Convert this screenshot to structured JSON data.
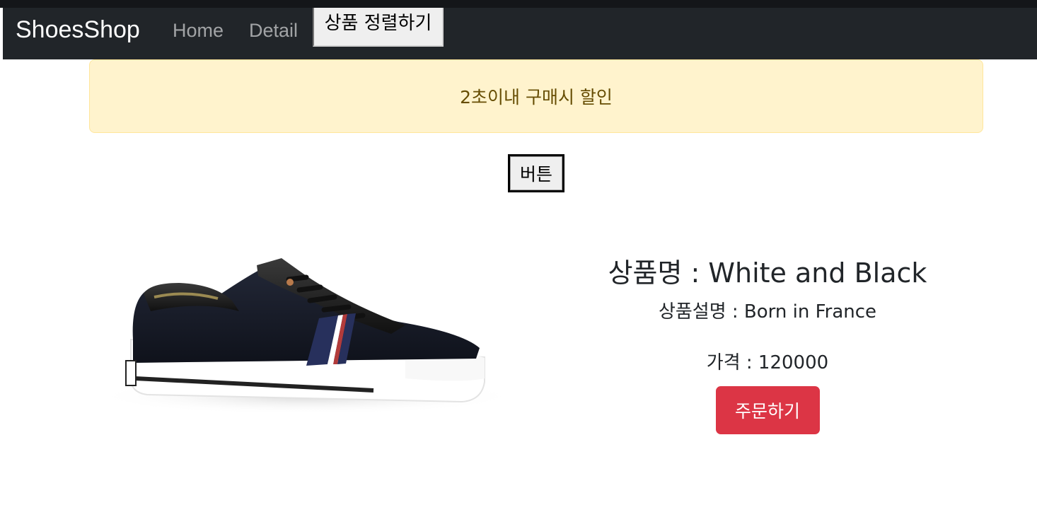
{
  "navbar": {
    "brand": "ShoesShop",
    "links": [
      "Home",
      "Detail"
    ],
    "sort_button_label": "상품 정렬하기"
  },
  "alert": {
    "text": "2초이내 구매시 할인"
  },
  "button": {
    "label": "버튼"
  },
  "product": {
    "image_icon": "sneaker-image",
    "title": "상품명 : White and Black",
    "description": "상품설명 : Born in France",
    "price": "가격 : 120000",
    "order_label": "주문하기"
  },
  "colors": {
    "navbar_bg": "#212529",
    "alert_bg": "#fff3cd",
    "alert_text": "#664d03",
    "order_button": "#dc3545"
  }
}
